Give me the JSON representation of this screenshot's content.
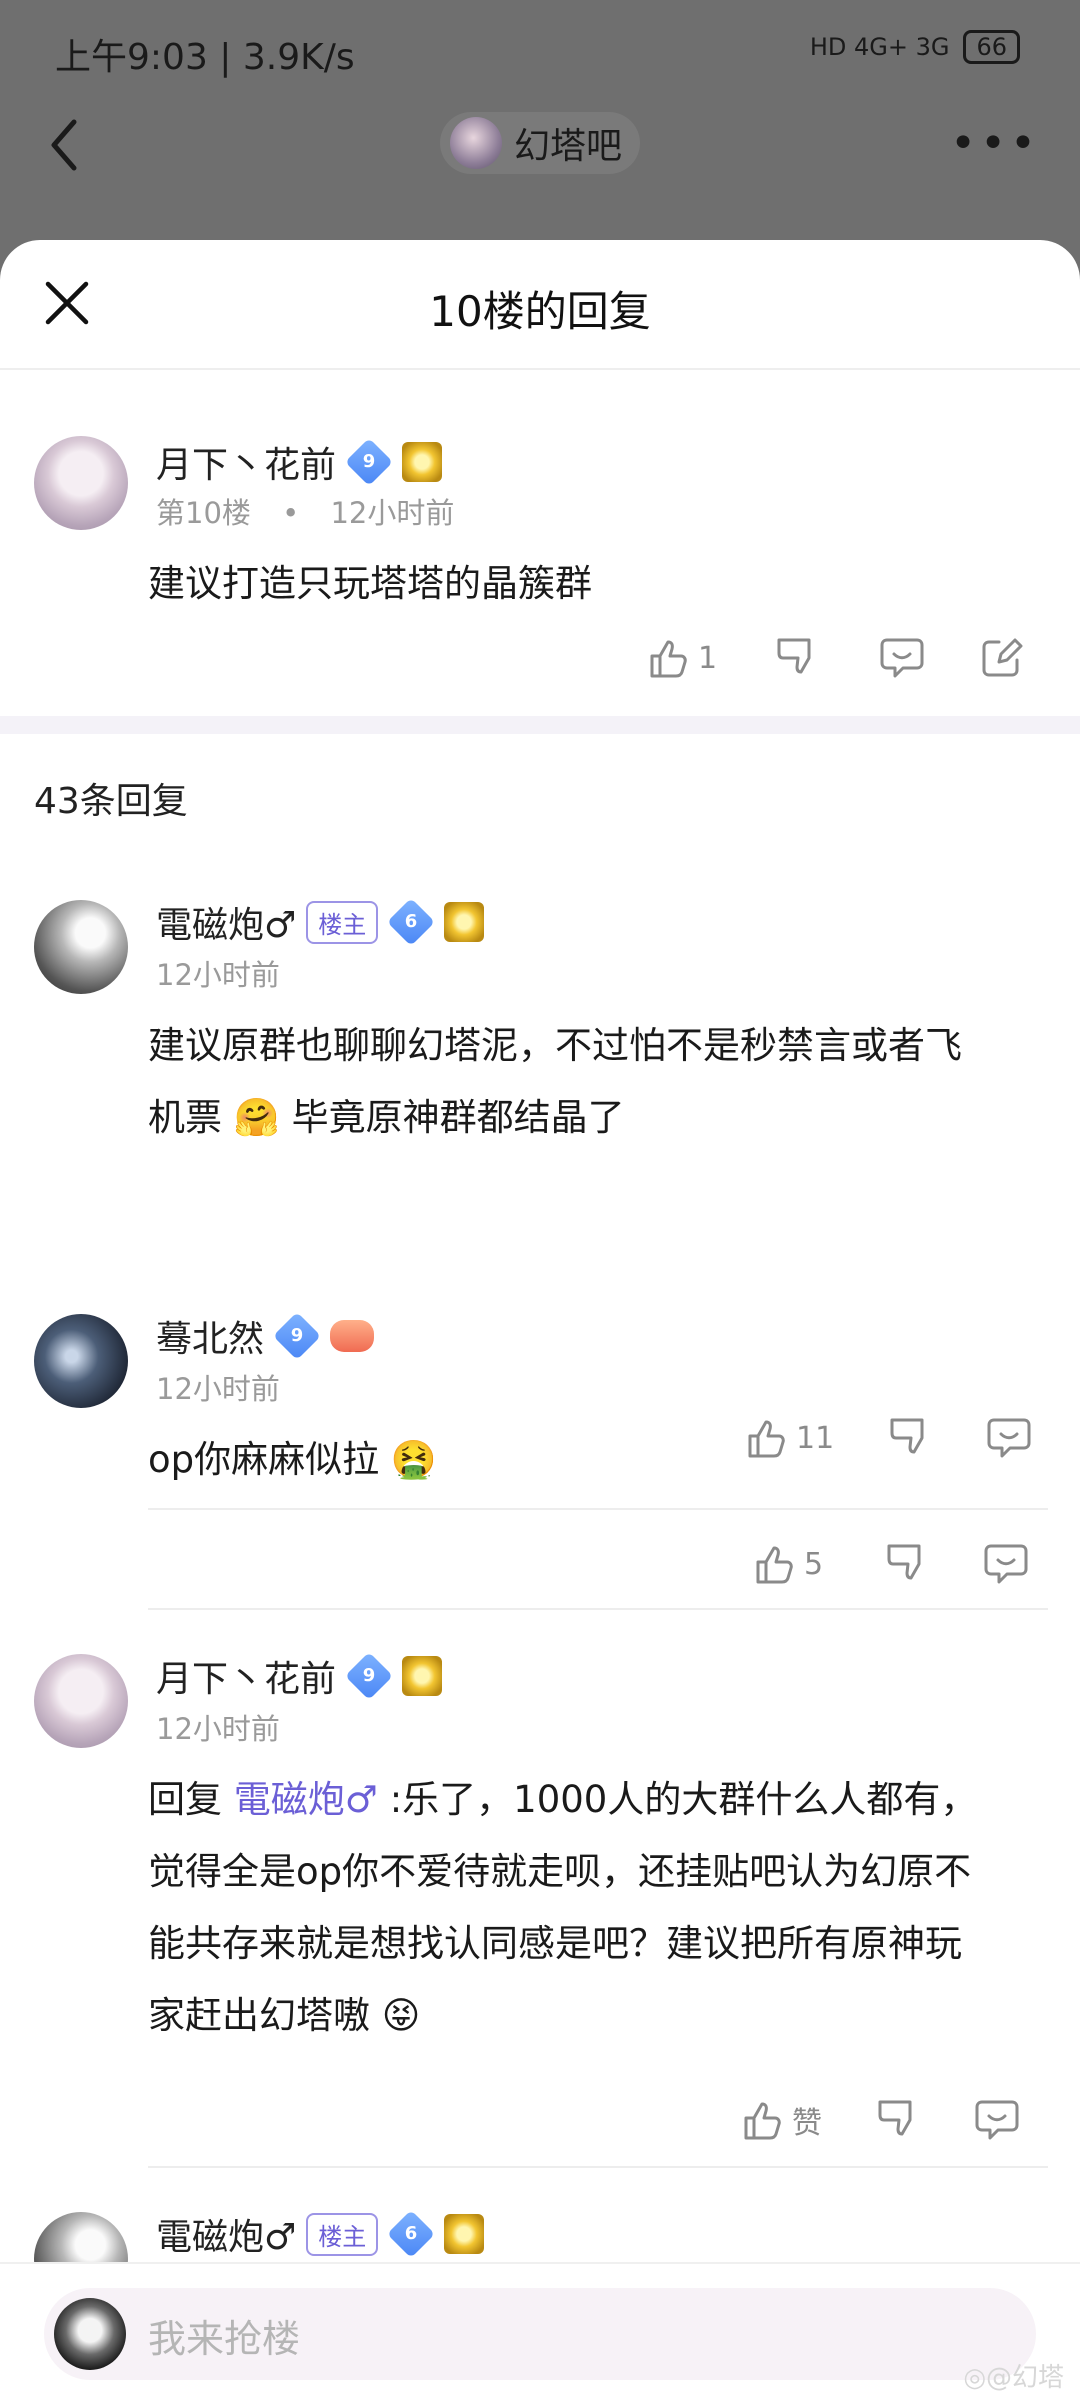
{
  "status_bar": {
    "time": "上午9:03 | 3.9K/s",
    "signal": "HD 4G+ 3G",
    "battery": "66"
  },
  "nav": {
    "forum_name": "幻塔吧",
    "more": "•••"
  },
  "sheet": {
    "title": "10楼的回复"
  },
  "main_post": {
    "username": "月下丶花前",
    "level": "9",
    "floor": "第10楼",
    "separator": "•",
    "time": "12小时前",
    "content": "建议打造只玩塔塔的晶簇群",
    "like_count": "1"
  },
  "replies_header": "43条回复",
  "replies": [
    {
      "username": "電磁炮♂",
      "host_badge": "楼主",
      "level": "6",
      "time": "12小时前",
      "content_line1": "建议原群也聊聊幻塔泥，不过怕不是秒禁言或者飞",
      "content_line2_a": "机票",
      "content_line2_b": "毕竟原神群都结晶了",
      "like_count": "11",
      "emoji_a": "🤗"
    },
    {
      "username": "蓦北然",
      "level": "9",
      "time": "12小时前",
      "content": "op你麻麻似拉",
      "emoji": "🤮",
      "like_count": "5"
    },
    {
      "username": "月下丶花前",
      "level": "9",
      "time": "12小时前",
      "reply_prefix": "回复",
      "mention": "電磁炮♂",
      "line1": ":乐了，1000人的大群什么人都有，",
      "line2": "觉得全是op你不爱待就走呗，还挂贴吧认为幻原不",
      "line3": "能共存来就是想找认同感是吧？建议把所有原神玩",
      "line4": "家赶出幻塔嗷",
      "emoji": "😝",
      "like_label": "赞"
    },
    {
      "username": "電磁炮♂",
      "host_badge": "楼主",
      "level": "6"
    }
  ],
  "input": {
    "placeholder": "我来抢楼"
  },
  "watermark": "◎@幻塔"
}
